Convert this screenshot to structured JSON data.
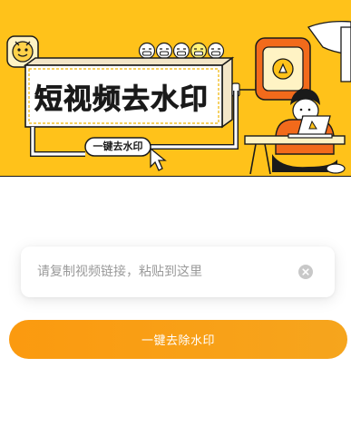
{
  "banner": {
    "title": "短视频去水印",
    "pill_label": "一键去水印"
  },
  "link_input": {
    "value": "",
    "placeholder": "请复制视频链接，粘贴到这里"
  },
  "action_button": {
    "label": "一键去除水印"
  },
  "colors": {
    "banner_background": "#ffc21a",
    "button_gradient_start": "#fb9a0f",
    "button_gradient_end": "#f6a51d",
    "illustration_accent": "#f26a1b",
    "placeholder_text": "#9a9a9a"
  },
  "icons": [
    "logo-badge-icon",
    "emoji-faces-icon",
    "cursor-arrow-icon",
    "phone-play-icon",
    "laptop-icon",
    "clear-input-icon"
  ]
}
